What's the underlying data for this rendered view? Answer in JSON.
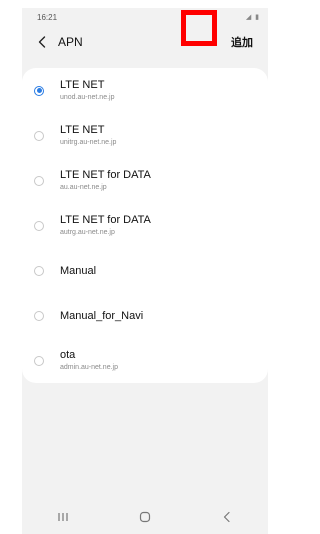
{
  "status_bar": {
    "time": "16:21",
    "icons": "◢ ▮"
  },
  "app_bar": {
    "title": "APN",
    "add_label": "追加"
  },
  "apn_list": [
    {
      "name": "LTE NET",
      "apn": "unod.au-net.ne.jp",
      "selected": true
    },
    {
      "name": "LTE NET",
      "apn": "unitrg.au-net.ne.jp",
      "selected": false
    },
    {
      "name": "LTE NET for DATA",
      "apn": "au.au-net.ne.jp",
      "selected": false
    },
    {
      "name": "LTE NET for DATA",
      "apn": "autrg.au-net.ne.jp",
      "selected": false
    },
    {
      "name": "Manual",
      "apn": "",
      "selected": false
    },
    {
      "name": "Manual_for_Navi",
      "apn": "",
      "selected": false
    },
    {
      "name": "ota",
      "apn": "admin.au-net.ne.jp",
      "selected": false
    }
  ],
  "nav_bar": {
    "recents_icon": "recents-icon",
    "home_icon": "home-icon",
    "back_icon": "back-nav-icon"
  },
  "colors": {
    "accent": "#2a7ce3",
    "highlight": "#ff0000",
    "background": "#f2f2f2"
  }
}
